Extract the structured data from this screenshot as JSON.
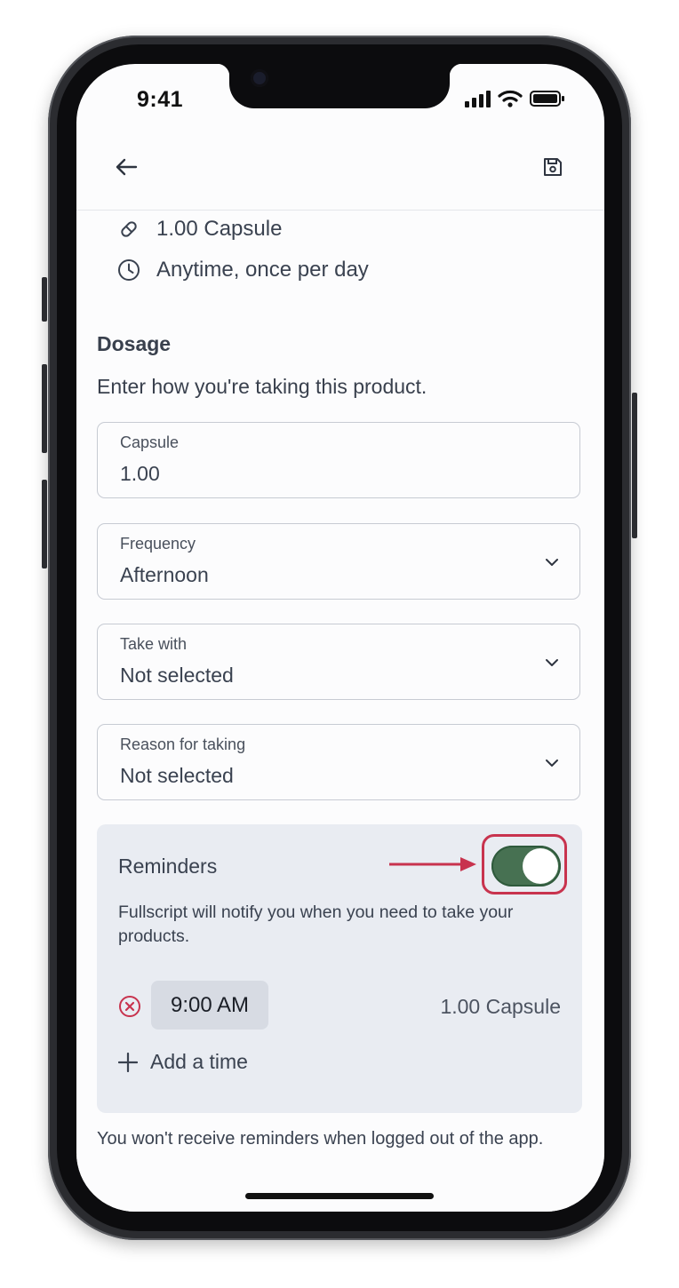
{
  "status_bar": {
    "time": "9:41"
  },
  "header": {
    "back_icon": "arrow-left-icon",
    "save_icon": "floppy-disk-icon"
  },
  "summary": {
    "dose": "1.00 Capsule",
    "dose_icon": "pill-icon",
    "schedule": "Anytime, once per day",
    "schedule_icon": "clock-icon"
  },
  "dosage": {
    "title": "Dosage",
    "subtitle": "Enter how you're taking this product.",
    "fields": {
      "capsule": {
        "label": "Capsule",
        "value": "1.00"
      },
      "frequency": {
        "label": "Frequency",
        "value": "Afternoon"
      },
      "take_with": {
        "label": "Take with",
        "value": "Not selected"
      },
      "reason": {
        "label": "Reason for taking",
        "value": "Not selected"
      }
    }
  },
  "reminders": {
    "title": "Reminders",
    "enabled": true,
    "description": "Fullscript will notify you when you need to take your products.",
    "times": [
      {
        "time": "9:00 AM",
        "dose": "1.00 Capsule"
      }
    ],
    "add_label": "Add a time",
    "toggle_color": "#477152",
    "highlight_color": "#c8334e"
  },
  "footer": {
    "note": "You won't receive reminders when logged out of the app."
  }
}
